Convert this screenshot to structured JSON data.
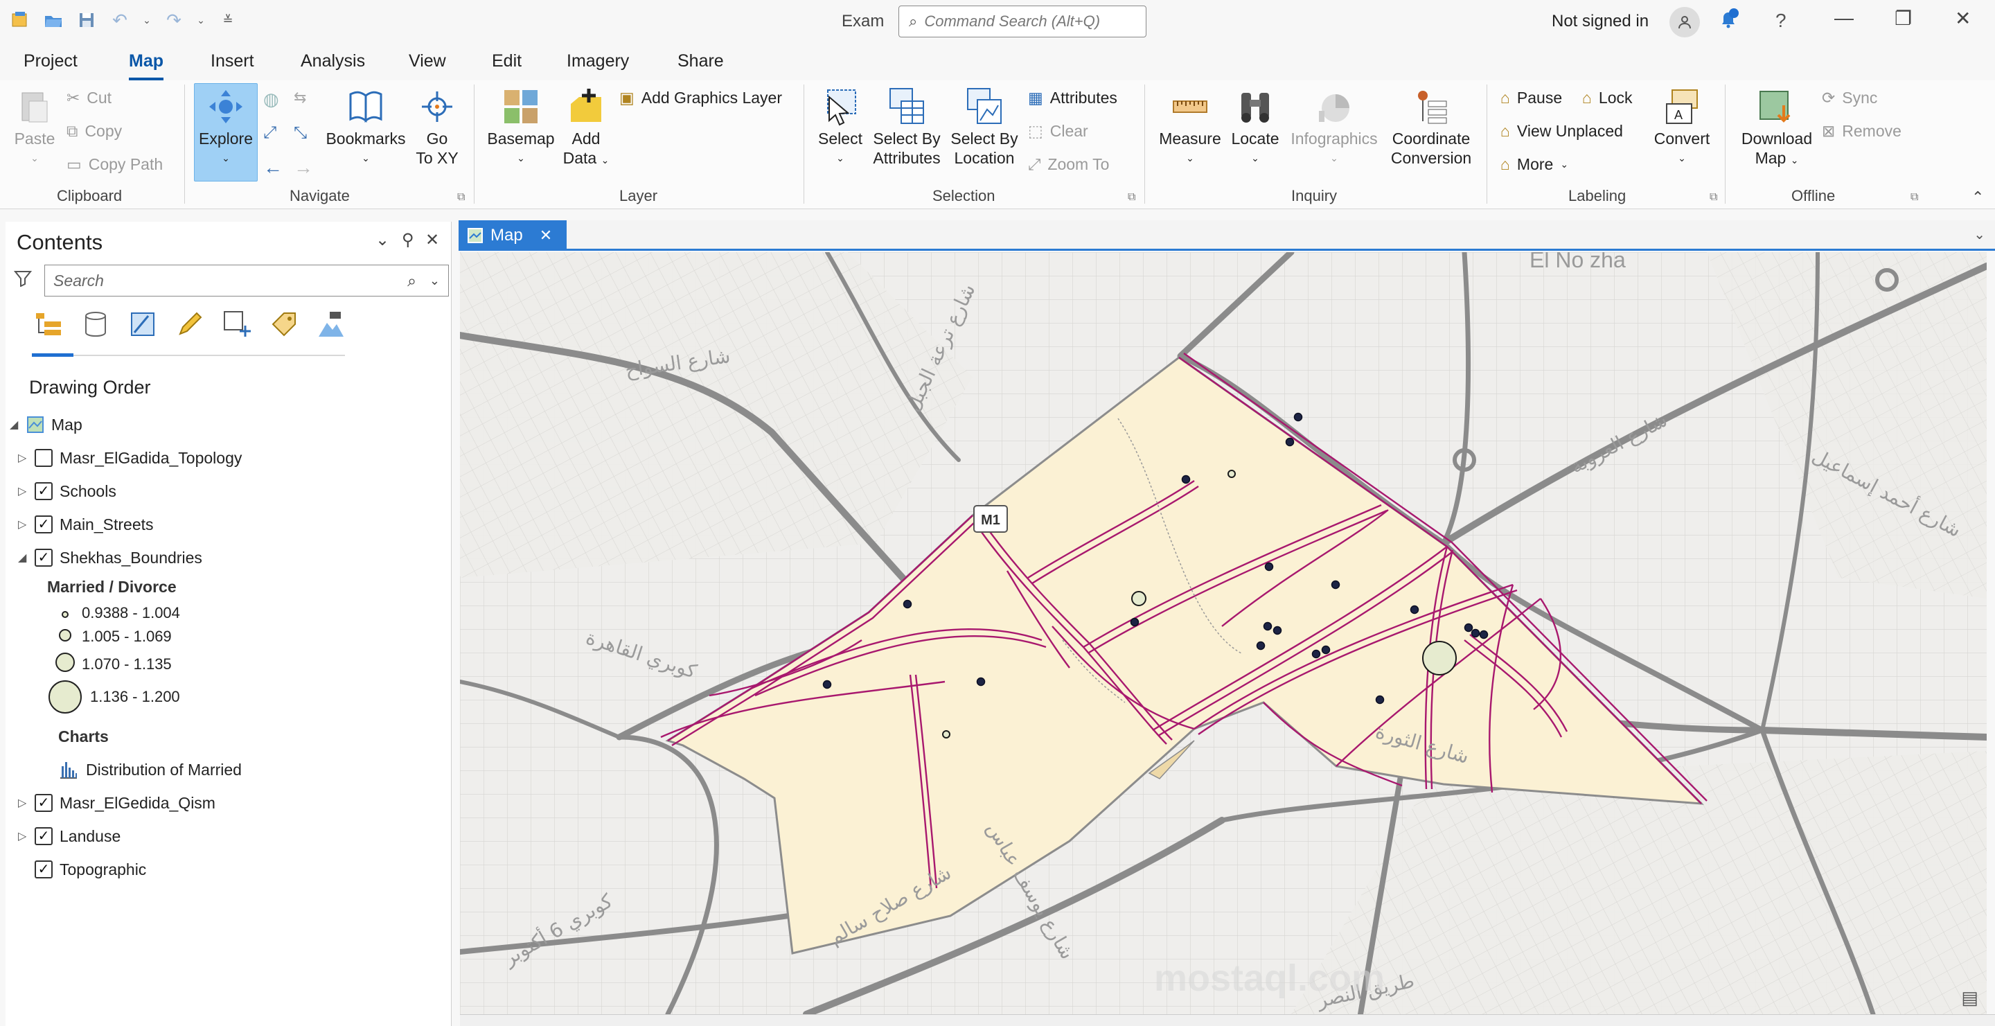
{
  "app": {
    "project_name": "Exam",
    "command_search_placeholder": "Command Search (Alt+Q)",
    "signin_text": "Not signed in"
  },
  "tabs": [
    "Project",
    "Map",
    "Insert",
    "Analysis",
    "View",
    "Edit",
    "Imagery",
    "Share"
  ],
  "active_tab": "Map",
  "ribbon": {
    "clipboard": {
      "paste": "Paste",
      "cut": "Cut",
      "copy": "Copy",
      "copy_path": "Copy Path",
      "label": "Clipboard"
    },
    "navigate": {
      "explore": "Explore",
      "bookmarks": "Bookmarks",
      "go_to_xy_1": "Go",
      "go_to_xy_2": "To XY",
      "label": "Navigate"
    },
    "layer": {
      "basemap": "Basemap",
      "add_data_1": "Add",
      "add_data_2": "Data",
      "add_graphics_layer": "Add Graphics Layer",
      "label": "Layer"
    },
    "selection": {
      "select": "Select",
      "select_by_attributes_1": "Select By",
      "select_by_attributes_2": "Attributes",
      "select_by_location_1": "Select By",
      "select_by_location_2": "Location",
      "attributes": "Attributes",
      "clear": "Clear",
      "zoom_to": "Zoom To",
      "label": "Selection"
    },
    "inquiry": {
      "measure": "Measure",
      "locate": "Locate",
      "infographics": "Infographics",
      "coord_1": "Coordinate",
      "coord_2": "Conversion",
      "label": "Inquiry"
    },
    "labeling": {
      "pause": "Pause",
      "lock": "Lock",
      "view_unplaced": "View Unplaced",
      "more": "More",
      "convert": "Convert",
      "label": "Labeling"
    },
    "offline": {
      "download_1": "Download",
      "download_2": "Map",
      "sync": "Sync",
      "remove": "Remove",
      "label": "Offline"
    }
  },
  "contents": {
    "title": "Contents",
    "search_placeholder": "Search",
    "heading": "Drawing Order",
    "map_name": "Map",
    "layers": [
      {
        "name": "Masr_ElGadida_Topology",
        "checked": false
      },
      {
        "name": "Schools",
        "checked": true
      },
      {
        "name": "Main_Streets",
        "checked": true
      },
      {
        "name": "Shekhas_Boundries",
        "checked": true
      },
      {
        "name": "Masr_ElGedida_Qism",
        "checked": true
      },
      {
        "name": "Landuse",
        "checked": true
      },
      {
        "name": "Topographic",
        "checked": true
      }
    ],
    "legend": {
      "title": "Married / Divorce",
      "classes": [
        "0.9388 - 1.004",
        "1.005 - 1.069",
        "1.070 - 1.135",
        "1.136 - 1.200"
      ]
    },
    "charts_heading": "Charts",
    "chart_name": "Distribution of Married"
  },
  "map": {
    "tab_label": "Map",
    "place_label": "El No zha",
    "street_labels": [
      "شارع السواح",
      "شارع ترعة الجبل",
      "شارع العروبة",
      "شارع أحمد إسماعيل",
      "كوبري القاهرة",
      "شارع الثورة",
      "شارع صلاح سالم",
      "كوبري 6 أكتوبر",
      "شارع يوسف عباس",
      "طريق النصر"
    ],
    "road_shield": "M1"
  },
  "colors": {
    "accent": "#2c7bd3",
    "boundary": "#a8186e",
    "polygon_fill": "#fbf1d4",
    "point": "#1d2444"
  }
}
